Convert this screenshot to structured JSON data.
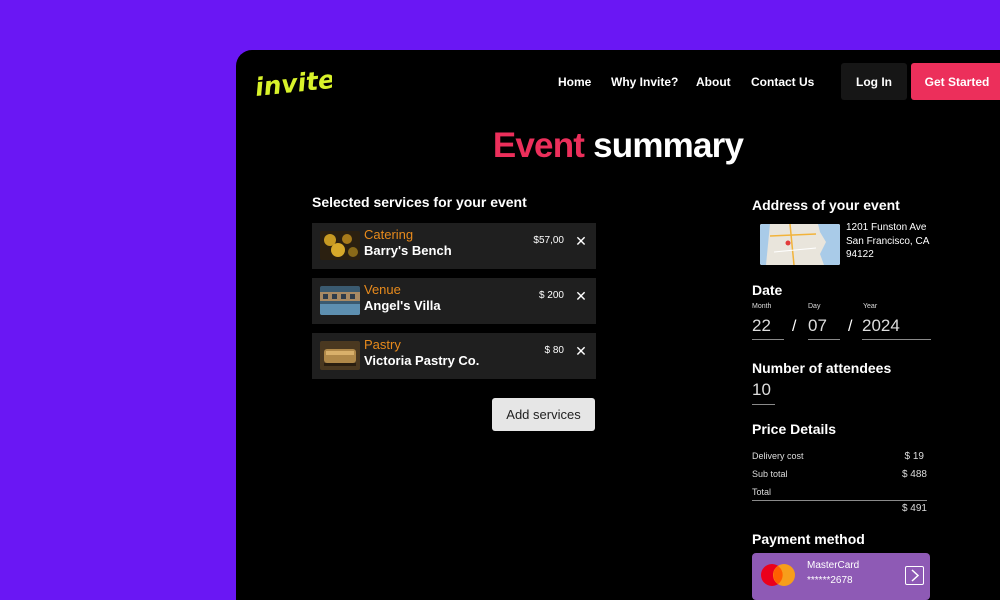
{
  "brand": {
    "logo_text": "invite"
  },
  "nav": {
    "links": [
      "Home",
      "Why Invite?",
      "About",
      "Contact Us"
    ],
    "login": "Log In",
    "get_started": "Get Started"
  },
  "page": {
    "title_accent": "Event",
    "title_rest": "summary"
  },
  "services": {
    "heading": "Selected services for your event",
    "items": [
      {
        "category": "Catering",
        "name": "Barry's Bench",
        "price": "$57,00"
      },
      {
        "category": "Venue",
        "name": "Angel's Villa",
        "price": "$ 200"
      },
      {
        "category": "Pastry",
        "name": "Victoria Pastry Co.",
        "price": "$ 80"
      }
    ],
    "remove_glyph": "✕",
    "add_label": "Add services"
  },
  "address": {
    "heading": "Address of your event",
    "line1": "1201 Funston Ave",
    "line2": "San Francisco, CA",
    "line3": "94122"
  },
  "date": {
    "heading": "Date",
    "month_label": "Month",
    "month": "22",
    "day_label": "Day",
    "day": "07",
    "year_label": "Year",
    "year": "2024",
    "separator": "/"
  },
  "attendees": {
    "heading": "Number of attendees",
    "value": "10"
  },
  "price": {
    "heading": "Price Details",
    "delivery_label": "Delivery cost",
    "delivery": "$ 19",
    "subtotal_label": "Sub total",
    "subtotal": "$ 488",
    "total_label": "Total",
    "total": "$ 491"
  },
  "payment": {
    "heading": "Payment method",
    "brand": "MasterCard",
    "number": "******2678"
  },
  "colors": {
    "background": "#6a17f4",
    "accent": "#ec2f5b",
    "logo": "#d8f22a",
    "category": "#e78a1c",
    "card": "#8e5ab5"
  },
  "icons": [
    "close-icon",
    "chevron-right-icon",
    "mastercard-icon",
    "map-thumbnail"
  ]
}
